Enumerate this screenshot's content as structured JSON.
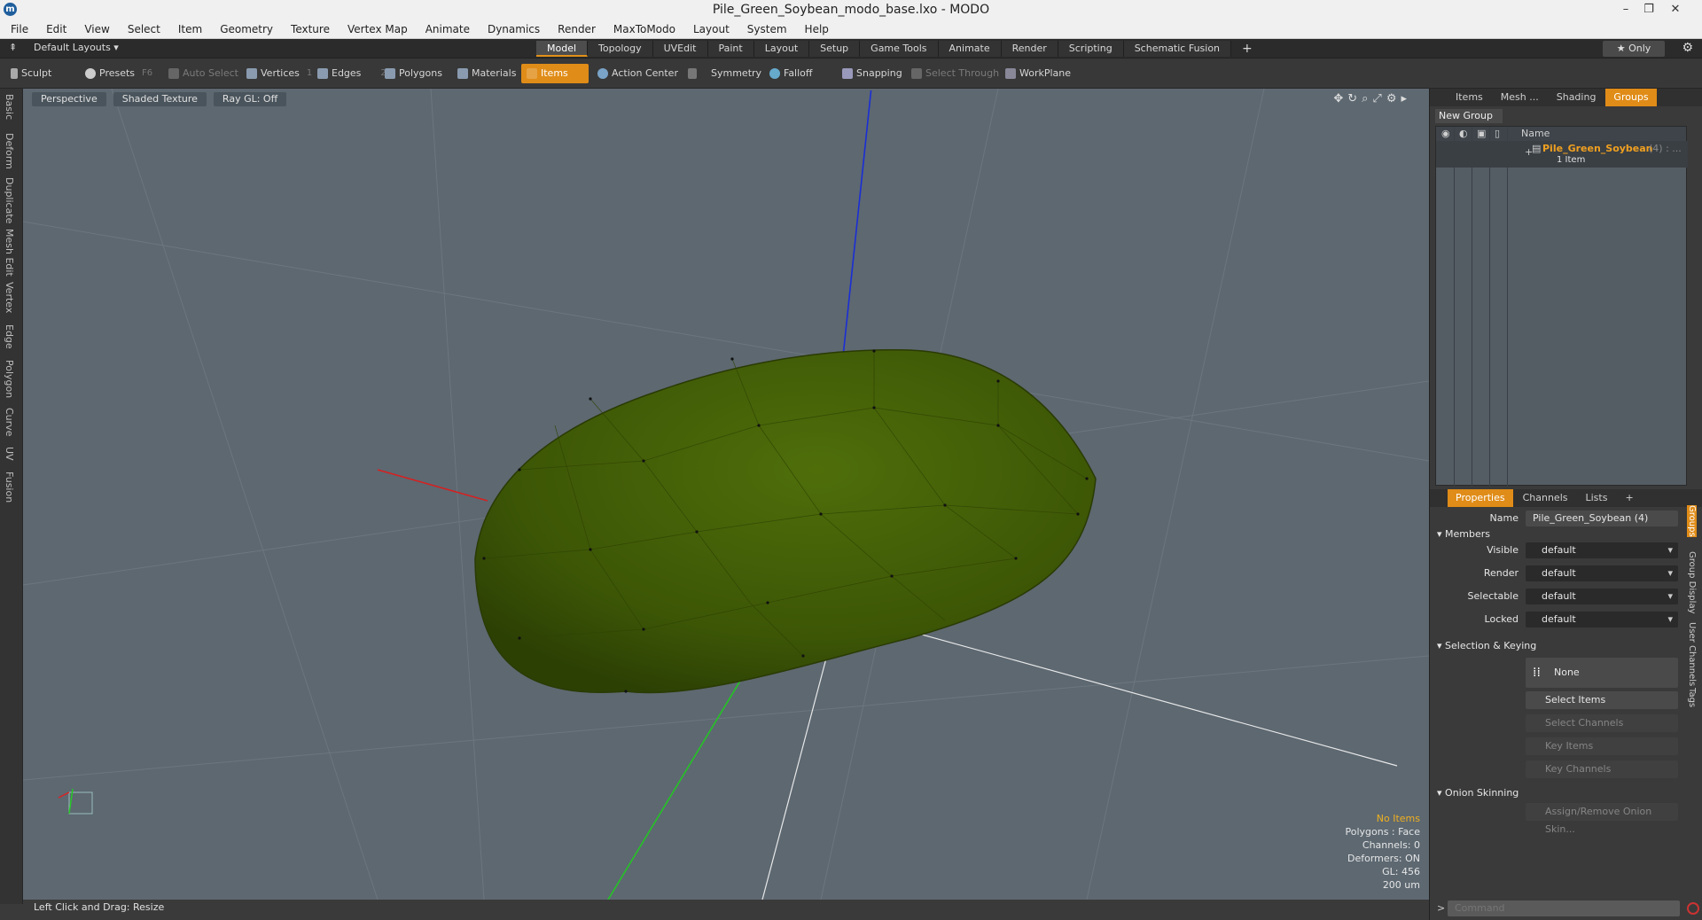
{
  "window": {
    "title": "Pile_Green_Soybean_modo_base.lxo - MODO",
    "logo": "modo-logo-icon",
    "min": "–",
    "max": "❐",
    "close": "✕"
  },
  "menu": [
    "File",
    "Edit",
    "View",
    "Select",
    "Item",
    "Geometry",
    "Texture",
    "Vertex Map",
    "Animate",
    "Dynamics",
    "Render",
    "MaxToModo",
    "Layout",
    "System",
    "Help"
  ],
  "layoutbar": {
    "layouts": "Default Layouts ▾",
    "tabs": [
      "Model",
      "Topology",
      "UVEdit",
      "Paint",
      "Layout",
      "Setup",
      "Game Tools",
      "Animate",
      "Render",
      "Scripting",
      "Schematic Fusion"
    ],
    "active_tab": "Model",
    "plus": "+",
    "only": "★  Only",
    "gear": "⚙"
  },
  "toolbar": {
    "sculpt": "Sculpt",
    "presets": "Presets",
    "presets_key": "F6",
    "auto_select": "Auto Select",
    "vertices": "Vertices",
    "vertices_key": "1",
    "edges": "Edges",
    "edges_key": "2",
    "polygons": "Polygons",
    "materials": "Materials",
    "items": "Items",
    "action_center": "Action Center",
    "symmetry": "Symmetry",
    "falloff": "Falloff",
    "snapping": "Snapping",
    "select_through": "Select Through",
    "workplane": "WorkPlane"
  },
  "left_tabs": [
    "Basic",
    "Deform",
    "Duplicate",
    "Mesh Edit",
    "Vertex",
    "Edge",
    "Polygon",
    "Curve",
    "UV",
    "Fusion"
  ],
  "viewport": {
    "view": "Perspective",
    "shading": "Shaded Texture",
    "raygl": "Ray GL: Off",
    "info": [
      "No Items",
      "Polygons : Face",
      "Channels: 0",
      "Deformers: ON",
      "GL: 456",
      "200 um"
    ]
  },
  "status": "Left Click and Drag:  Resize",
  "groups_panel": {
    "tabs": [
      "Items",
      "Mesh ...",
      "Shading",
      "Groups"
    ],
    "active_tab": "Groups",
    "new_group": "New Group",
    "col_name": "Name",
    "group_name": "Pile_Green_Soybean",
    "group_count": "(4) : ...",
    "group_sub": "1 Item"
  },
  "properties": {
    "tabs": [
      "Properties",
      "Channels",
      "Lists"
    ],
    "plus": "+",
    "name_label": "Name",
    "name_value": "Pile_Green_Soybean (4)",
    "members": "Members",
    "visible_label": "Visible",
    "visible": "default",
    "render_label": "Render",
    "render": "default",
    "selectable_label": "Selectable",
    "selectable": "default",
    "locked_label": "Locked",
    "locked": "default",
    "sel_keying": "Selection & Keying",
    "none": "None",
    "select_items": "Select Items",
    "select_channels": "Select Channels",
    "key_items": "Key Items",
    "key_channels": "Key Channels",
    "onion": "Onion Skinning",
    "assign_onion": "Assign/Remove Onion Skin...",
    "right_tabs": [
      "Groups",
      "Group Display",
      "User Channels",
      "Tags"
    ]
  },
  "command": {
    "prompt": ">",
    "placeholder": "Command"
  },
  "colors": {
    "accent": "#e08c18",
    "viewport": "#5d6871",
    "mesh": "#4a6a08"
  }
}
